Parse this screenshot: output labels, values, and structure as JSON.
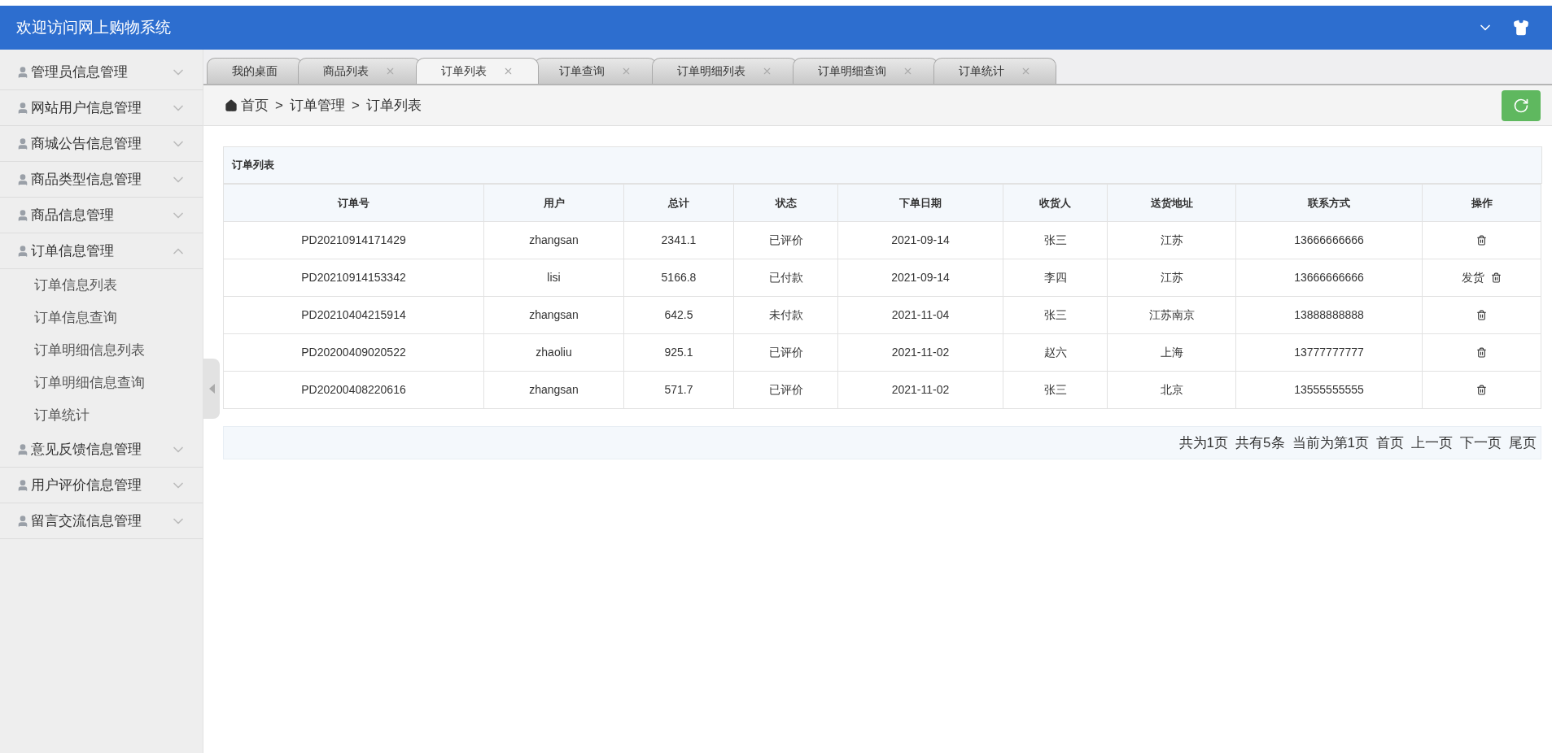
{
  "header": {
    "title": "欢迎访问网上购物系统"
  },
  "sidebar": {
    "items": [
      {
        "label": "管理员信息管理",
        "expanded": false
      },
      {
        "label": "网站用户信息管理",
        "expanded": false
      },
      {
        "label": "商城公告信息管理",
        "expanded": false
      },
      {
        "label": "商品类型信息管理",
        "expanded": false
      },
      {
        "label": "商品信息管理",
        "expanded": false
      },
      {
        "label": "订单信息管理",
        "expanded": true,
        "children": [
          {
            "label": "订单信息列表"
          },
          {
            "label": "订单信息查询"
          },
          {
            "label": "订单明细信息列表"
          },
          {
            "label": "订单明细信息查询"
          },
          {
            "label": "订单统计"
          }
        ]
      },
      {
        "label": "意见反馈信息管理",
        "expanded": false
      },
      {
        "label": "用户评价信息管理",
        "expanded": false
      },
      {
        "label": "留言交流信息管理",
        "expanded": false
      }
    ]
  },
  "tabs": [
    {
      "label": "我的桌面",
      "selected": false,
      "closable": false
    },
    {
      "label": "商品列表",
      "selected": false,
      "closable": true
    },
    {
      "label": "订单列表",
      "selected": true,
      "closable": true
    },
    {
      "label": "订单查询",
      "selected": false,
      "closable": true
    },
    {
      "label": "订单明细列表",
      "selected": false,
      "closable": true
    },
    {
      "label": "订单明细查询",
      "selected": false,
      "closable": true
    },
    {
      "label": "订单统计",
      "selected": false,
      "closable": true
    }
  ],
  "breadcrumb": [
    {
      "kind": "item",
      "label": "首页"
    },
    {
      "kind": "separator",
      "label": ">"
    },
    {
      "kind": "item",
      "label": "订单管理"
    },
    {
      "kind": "separator",
      "label": ">"
    },
    {
      "kind": "item",
      "label": "订单列表"
    }
  ],
  "table": {
    "title": "订单列表",
    "columns": [
      "订单号",
      "用户",
      "总计",
      "状态",
      "下单日期",
      "收货人",
      "送货地址",
      "联系方式",
      "操作"
    ],
    "rows": [
      {
        "cells": [
          "PD20210914171429",
          "zhangsan",
          "2341.1",
          "已评价",
          "2021-09-14",
          "张三",
          "江苏",
          "13666666666"
        ],
        "actions": [
          {
            "kind": "delete"
          }
        ]
      },
      {
        "cells": [
          "PD20210914153342",
          "lisi",
          "5166.8",
          "已付款",
          "2021-09-14",
          "李四",
          "江苏",
          "13666666666"
        ],
        "actions": [
          {
            "kind": "link",
            "label": "发货"
          },
          {
            "kind": "delete"
          }
        ]
      },
      {
        "cells": [
          "PD20210404215914",
          "zhangsan",
          "642.5",
          "未付款",
          "2021-11-04",
          "张三",
          "江苏南京",
          "13888888888"
        ],
        "actions": [
          {
            "kind": "delete"
          }
        ]
      },
      {
        "cells": [
          "PD20200409020522",
          "zhaoliu",
          "925.1",
          "已评价",
          "2021-11-02",
          "赵六",
          "上海",
          "13777777777"
        ],
        "actions": [
          {
            "kind": "delete"
          }
        ]
      },
      {
        "cells": [
          "PD20200408220616",
          "zhangsan",
          "571.7",
          "已评价",
          "2021-11-02",
          "张三",
          "北京",
          "13555555555"
        ],
        "actions": [
          {
            "kind": "delete"
          }
        ]
      }
    ]
  },
  "pagination": [
    "共为1页",
    "共有5条",
    "当前为第1页",
    "首页",
    "上一页",
    "下一页",
    "尾页"
  ]
}
